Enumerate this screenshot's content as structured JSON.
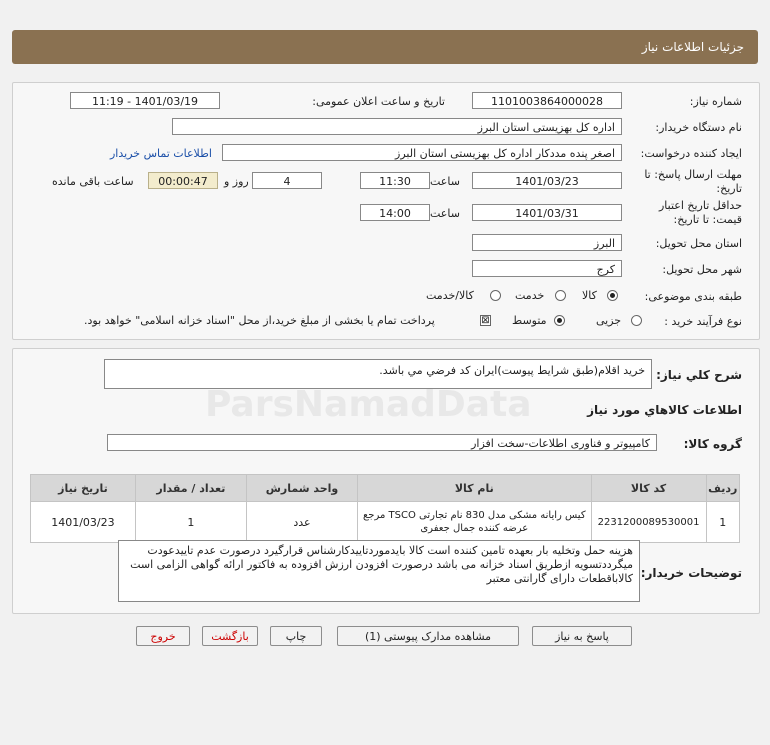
{
  "header": {
    "title": "جزئیات اطلاعات نیاز"
  },
  "fields": {
    "need_number_label": "شماره نیاز:",
    "need_number": "1101003864000028",
    "announce_label": "تاریخ و ساعت اعلان عمومی:",
    "announce_value": "1401/03/19 - 11:19",
    "buyer_org_label": "نام دستگاه خریدار:",
    "buyer_org": "اداره کل بهزیستی استان البرز",
    "creator_label": "ایجاد کننده درخواست:",
    "creator": "اصغر پنده مددکار اداره کل بهزیستی استان البرز",
    "contact_link": "اطلاعات تماس خریدار",
    "deadline_label": "مهلت ارسال پاسخ: تا تاریخ:",
    "deadline_date": "1401/03/23",
    "time_label": "ساعت",
    "deadline_time": "11:30",
    "days_value": "4",
    "days_label": "روز و",
    "remaining_value": "00:00:47",
    "remaining_label": "ساعت باقی مانده",
    "validity_label": "حداقل تاریخ اعتبار قیمت: تا تاریخ:",
    "validity_date": "1401/03/31",
    "validity_time": "14:00",
    "province_label": "استان محل تحویل:",
    "province": "البرز",
    "city_label": "شهر محل تحویل:",
    "city": "کرج",
    "category_label": "طبقه بندی موضوعی:",
    "category_options": [
      "کالا",
      "خدمت",
      "کالا/خدمت"
    ],
    "process_label": "نوع فرآیند خرید :",
    "process_options": [
      "جزیی",
      "متوسط"
    ],
    "payment_note": "پرداخت تمام یا بخشی از مبلغ خرید،از محل \"اسناد خزانه اسلامی\" خواهد بود."
  },
  "summary": {
    "label": "شرح کلي نياز:",
    "value": "خريد اقلام(طبق شرايط پيوست)ايران کد فرضي مي باشد."
  },
  "goods": {
    "section_title": "اطلاعات کالاهاي مورد نياز",
    "group_label": "گروه کالا:",
    "group_value": "کامپيوتر و فناوری اطلاعات-سخت افزار",
    "columns": [
      "ردیف",
      "کد کالا",
      "نام کالا",
      "واحد شمارش",
      "تعداد / مقدار",
      "تاریخ نیاز"
    ],
    "rows": [
      {
        "index": "1",
        "code": "2231200089530001",
        "name": "کیس رایانه مشکی مدل 830 نام تجارتی TSCO مرجع عرضه کننده جمال جعفری",
        "unit": "عدد",
        "qty": "1",
        "date": "1401/03/23"
      }
    ]
  },
  "buyer_notes": {
    "label": "توضیحات خریدار:",
    "text": "هزینه حمل وتخلیه بار بعهده تامین کننده است کالا بایدموردتاییدکارشناس قرارگیرد درصورت عدم تاییدعودت میگرددتسویه ازطریق اسناد خزانه می باشد درصورت افزودن ارزش افزوده به فاکتور ارائه گواهی الزامی است کالاباقطعات دارای گارانتی معتبر"
  },
  "buttons": {
    "reply": "پاسخ به نیاز",
    "attachments": "مشاهده مدارک پیوستی (1)",
    "print": "چاپ",
    "back": "بازگشت",
    "exit": "خروج"
  },
  "watermark": {
    "text": "ParsNamadData"
  },
  "colors": {
    "header_bg": "#8a7151",
    "link": "#1b4fa8",
    "remaining_bg": "#f3eccd"
  }
}
